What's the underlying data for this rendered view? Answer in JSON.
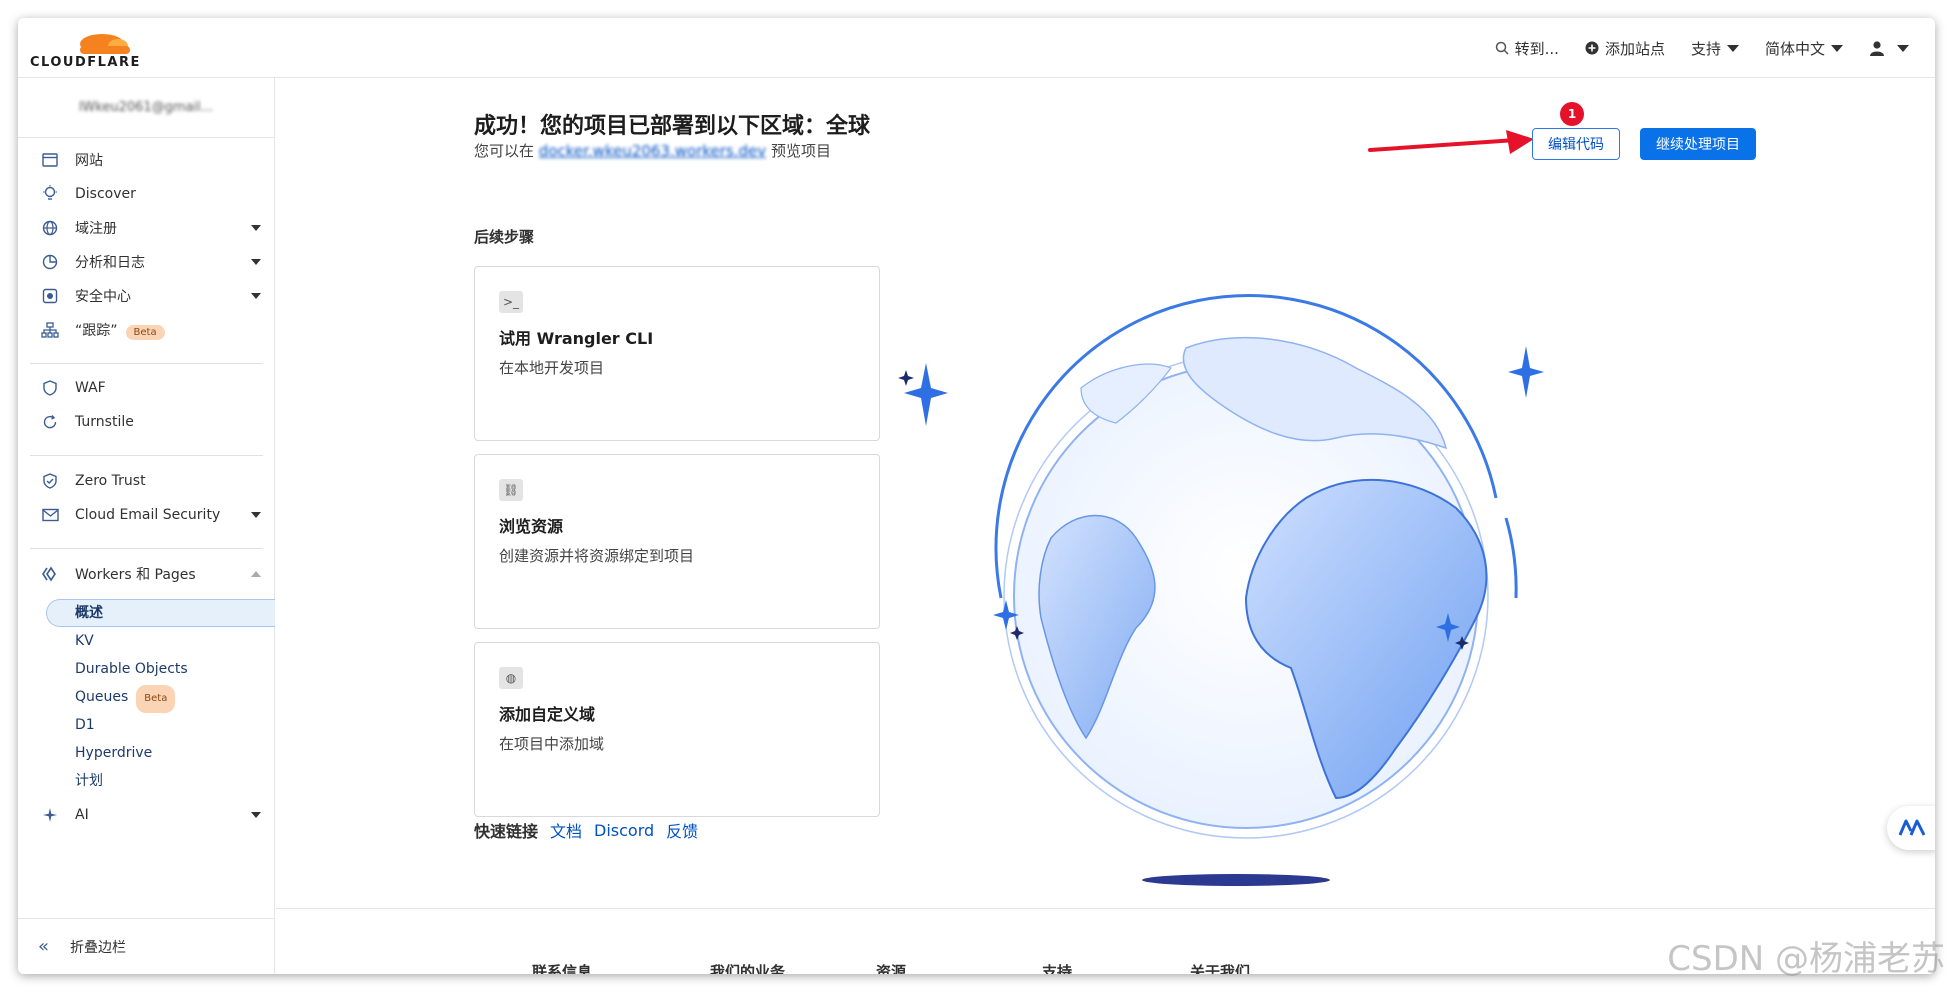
{
  "topbar": {
    "logo_text": "CLOUDFLARE",
    "goto_label": "转到...",
    "add_site_label": "添加站点",
    "support_label": "支持",
    "language_label": "简体中文"
  },
  "sidebar": {
    "account_email": "lWkeu2061@gmail...",
    "items": [
      {
        "label": "网站"
      },
      {
        "label": "Discover"
      },
      {
        "label": "域注册"
      },
      {
        "label": "分析和日志"
      },
      {
        "label": "安全中心"
      },
      {
        "label": "“跟踪”",
        "badge": "Beta"
      },
      {
        "label": "WAF"
      },
      {
        "label": "Turnstile"
      },
      {
        "label": "Zero Trust"
      },
      {
        "label": "Cloud Email Security"
      },
      {
        "label": "Workers 和 Pages"
      },
      {
        "label": "AI"
      }
    ],
    "sub_items": [
      {
        "label": "概述"
      },
      {
        "label": "KV"
      },
      {
        "label": "Durable Objects"
      },
      {
        "label": "Queues",
        "badge": "Beta"
      },
      {
        "label": "D1"
      },
      {
        "label": "Hyperdrive"
      },
      {
        "label": "计划"
      }
    ],
    "collapse_label": "折叠边栏"
  },
  "main": {
    "success_title": "成功！您的项目已部署到以下区域：全球",
    "preview_prefix": "您可以在",
    "preview_link": "docker.wkeu2063.workers.dev",
    "preview_suffix": "预览项目",
    "edit_code_button": "编辑代码",
    "continue_button": "继续处理项目",
    "step_marker": "1",
    "next_steps_title": "后续步骤",
    "cards": [
      {
        "title": "试用 Wrangler CLI",
        "desc": "在本地开发项目",
        "icon": "terminal-icon"
      },
      {
        "title": "浏览资源",
        "desc": "创建资源并将资源绑定到项目",
        "icon": "link-icon"
      },
      {
        "title": "添加自定义域",
        "desc": "在项目中添加域",
        "icon": "globe-icon"
      }
    ],
    "quick_links_title": "快速链接",
    "quick_links": [
      "文档",
      "Discord",
      "反馈"
    ]
  },
  "footer": {
    "columns": [
      "联系信息",
      "我们的业务",
      "资源",
      "支持",
      "关于我们"
    ]
  },
  "watermark": "CSDN @杨浦老苏",
  "colors": {
    "accent": "#0a72e8",
    "link": "#0051c3",
    "brand_orange": "#f6821f",
    "marker_red": "#e5122a"
  }
}
